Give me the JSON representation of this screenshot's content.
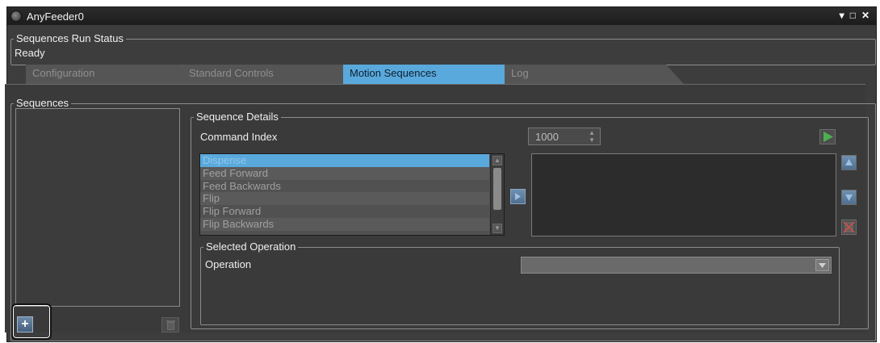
{
  "window": {
    "title": "AnyFeeder0",
    "controls": {
      "pin": "▾",
      "maximize": "□",
      "close": "✕"
    }
  },
  "run_status": {
    "legend": "Sequences Run Status",
    "value": "Ready"
  },
  "tabs": [
    {
      "label": "Configuration",
      "active": false
    },
    {
      "label": "Standard Controls",
      "active": false
    },
    {
      "label": "Motion Sequences",
      "active": true
    },
    {
      "label": "Log",
      "active": false
    }
  ],
  "sequences": {
    "legend": "Sequences",
    "add_icon": "plus-icon",
    "delete_icon": "trash-icon"
  },
  "details": {
    "legend": "Sequence Details",
    "command_index_label": "Command Index",
    "command_index_value": "1000",
    "operations": [
      "Dispense",
      "Feed Forward",
      "Feed Backwards",
      "Flip",
      "Flip Forward",
      "Flip Backwards"
    ],
    "selected_operation_index": 0
  },
  "selected_operation": {
    "legend": "Selected Operation",
    "operation_label": "Operation",
    "operation_value": ""
  },
  "colors": {
    "background": "#3d3d3d",
    "active_tab": "#5aa9dc",
    "run_button": "#4caf50"
  }
}
